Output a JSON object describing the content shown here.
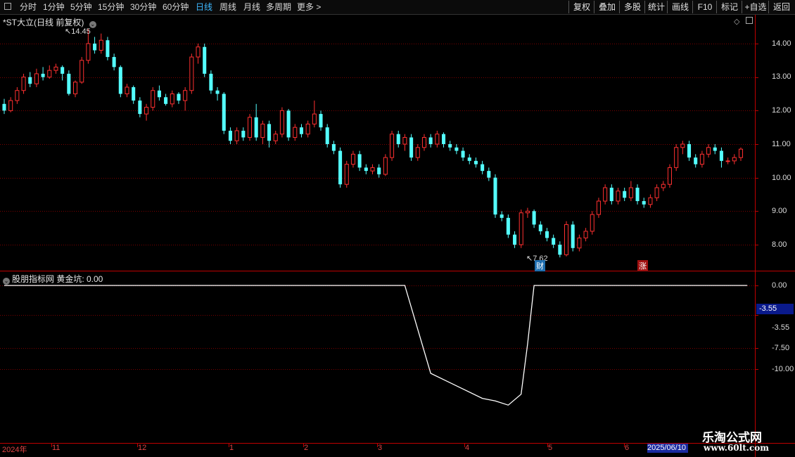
{
  "toolbar": {
    "periods": [
      "分时",
      "1分钟",
      "5分钟",
      "15分钟",
      "30分钟",
      "60分钟",
      "日线",
      "周线",
      "月线",
      "多周期",
      "更多 >"
    ],
    "active": "日线",
    "right_buttons": [
      "复权",
      "叠加",
      "多股",
      "统计",
      "画线",
      "F10",
      "标记",
      "+自选",
      "返回"
    ]
  },
  "main_chart": {
    "title": "*ST大立(日线 前复权)",
    "high_label": "14.45",
    "low_label": "7.62",
    "y_ticks": [
      "14.00",
      "13.00",
      "12.00",
      "11.00",
      "10.00",
      "9.00",
      "8.00"
    ],
    "event_labels": [
      "财",
      "涨"
    ]
  },
  "indicator": {
    "title": "股朋指标网  黄金坑: 0.00",
    "y_ticks": [
      "0.00",
      "-3.55",
      "-7.50",
      "-10.00"
    ],
    "current_value": "-3.55"
  },
  "x_axis": {
    "labels": [
      "2024年",
      "11",
      "12",
      "1",
      "2",
      "3",
      "4",
      "5",
      "6"
    ],
    "highlight": "2025/06/10"
  },
  "watermark": {
    "line1": "乐淘公式网",
    "line2": "www.60lt.com"
  },
  "colors": {
    "up": "#ff3030",
    "down": "#54ffff",
    "grid": "#7a0000",
    "axis": "#c00000",
    "line": "#ffffff"
  },
  "chart_data": {
    "type": "candlestick",
    "y_range": [
      7.4,
      14.8
    ],
    "candles": [
      [
        12.2,
        12.0,
        12.35,
        11.9
      ],
      [
        12.0,
        12.3,
        12.4,
        11.95
      ],
      [
        12.3,
        12.6,
        12.7,
        12.2
      ],
      [
        12.6,
        13.0,
        13.1,
        12.5
      ],
      [
        13.0,
        12.8,
        13.15,
        12.7
      ],
      [
        12.8,
        13.1,
        13.25,
        12.7
      ],
      [
        13.1,
        13.0,
        13.3,
        12.9
      ],
      [
        13.0,
        13.2,
        13.35,
        12.95
      ],
      [
        13.2,
        13.3,
        13.4,
        13.1
      ],
      [
        13.3,
        13.1,
        13.35,
        12.9
      ],
      [
        13.1,
        12.5,
        13.2,
        12.45
      ],
      [
        12.5,
        12.85,
        12.9,
        12.4
      ],
      [
        12.85,
        13.5,
        13.6,
        12.8
      ],
      [
        13.5,
        14.0,
        14.45,
        13.4
      ],
      [
        14.0,
        13.8,
        14.2,
        13.7
      ],
      [
        13.8,
        14.1,
        14.3,
        13.7
      ],
      [
        14.1,
        13.6,
        14.2,
        13.5
      ],
      [
        13.6,
        13.3,
        13.7,
        13.2
      ],
      [
        13.3,
        12.5,
        13.35,
        12.4
      ],
      [
        12.5,
        12.7,
        12.8,
        12.4
      ],
      [
        12.7,
        12.3,
        12.75,
        12.2
      ],
      [
        12.3,
        11.9,
        12.4,
        11.8
      ],
      [
        11.9,
        12.1,
        12.2,
        11.7
      ],
      [
        12.1,
        12.6,
        12.7,
        12.0
      ],
      [
        12.6,
        12.4,
        12.75,
        12.3
      ],
      [
        12.4,
        12.2,
        12.5,
        12.15
      ],
      [
        12.2,
        12.5,
        12.6,
        12.1
      ],
      [
        12.5,
        12.3,
        12.55,
        12.2
      ],
      [
        12.3,
        12.6,
        12.7,
        12.0
      ],
      [
        12.6,
        13.6,
        13.7,
        12.5
      ],
      [
        13.6,
        13.9,
        14.0,
        13.4
      ],
      [
        13.9,
        13.1,
        14.0,
        13.0
      ],
      [
        13.1,
        12.6,
        13.2,
        12.5
      ],
      [
        12.6,
        12.5,
        12.7,
        12.3
      ],
      [
        12.5,
        11.4,
        12.55,
        11.3
      ],
      [
        11.4,
        11.1,
        11.5,
        11.0
      ],
      [
        11.1,
        11.4,
        11.5,
        11.0
      ],
      [
        11.4,
        11.2,
        11.5,
        11.1
      ],
      [
        11.2,
        11.8,
        11.9,
        11.1
      ],
      [
        11.8,
        11.2,
        12.2,
        11.1
      ],
      [
        11.2,
        11.6,
        11.7,
        11.0
      ],
      [
        11.6,
        11.1,
        11.7,
        10.9
      ],
      [
        11.1,
        11.3,
        11.4,
        11.0
      ],
      [
        11.3,
        12.0,
        12.1,
        11.2
      ],
      [
        12.0,
        11.2,
        12.05,
        11.1
      ],
      [
        11.2,
        11.5,
        11.6,
        11.1
      ],
      [
        11.5,
        11.3,
        11.6,
        11.2
      ],
      [
        11.3,
        11.6,
        11.7,
        11.2
      ],
      [
        11.6,
        11.9,
        12.3,
        11.5
      ],
      [
        11.9,
        11.5,
        12.0,
        11.4
      ],
      [
        11.5,
        11.0,
        11.6,
        10.9
      ],
      [
        11.0,
        10.8,
        11.1,
        10.7
      ],
      [
        10.8,
        9.8,
        10.9,
        9.7
      ],
      [
        9.8,
        10.4,
        10.5,
        9.7
      ],
      [
        10.4,
        10.7,
        10.8,
        10.3
      ],
      [
        10.7,
        10.3,
        10.8,
        10.2
      ],
      [
        10.3,
        10.2,
        10.4,
        10.1
      ],
      [
        10.2,
        10.3,
        10.4,
        10.1
      ],
      [
        10.3,
        10.1,
        10.4,
        10.0
      ],
      [
        10.1,
        10.6,
        10.7,
        10.05
      ],
      [
        10.6,
        11.3,
        11.4,
        10.5
      ],
      [
        11.3,
        11.0,
        11.4,
        10.9
      ],
      [
        11.0,
        11.2,
        11.3,
        10.8
      ],
      [
        11.2,
        10.6,
        11.3,
        10.5
      ],
      [
        10.6,
        10.9,
        11.0,
        10.5
      ],
      [
        10.9,
        11.2,
        11.3,
        10.8
      ],
      [
        11.2,
        11.0,
        11.3,
        10.9
      ],
      [
        11.0,
        11.3,
        11.4,
        10.9
      ],
      [
        11.3,
        11.0,
        11.35,
        10.9
      ],
      [
        11.0,
        10.9,
        11.1,
        10.8
      ],
      [
        10.9,
        10.8,
        11.0,
        10.7
      ],
      [
        10.8,
        10.6,
        10.9,
        10.5
      ],
      [
        10.6,
        10.5,
        10.7,
        10.4
      ],
      [
        10.5,
        10.4,
        10.6,
        10.3
      ],
      [
        10.4,
        10.2,
        10.5,
        10.1
      ],
      [
        10.2,
        10.0,
        10.3,
        9.9
      ],
      [
        10.0,
        8.9,
        10.1,
        8.8
      ],
      [
        8.9,
        8.8,
        9.0,
        8.7
      ],
      [
        8.8,
        8.3,
        8.9,
        8.2
      ],
      [
        8.3,
        8.0,
        8.4,
        7.9
      ],
      [
        8.0,
        8.95,
        9.05,
        7.9
      ],
      [
        8.95,
        9.0,
        9.1,
        8.8
      ],
      [
        9.0,
        8.6,
        9.05,
        8.5
      ],
      [
        8.6,
        8.4,
        8.7,
        8.3
      ],
      [
        8.4,
        8.2,
        8.5,
        8.1
      ],
      [
        8.2,
        8.0,
        8.3,
        7.9
      ],
      [
        8.0,
        7.7,
        8.1,
        7.62
      ],
      [
        7.7,
        8.6,
        8.7,
        7.65
      ],
      [
        8.6,
        7.9,
        8.7,
        7.8
      ],
      [
        7.9,
        8.2,
        8.3,
        7.8
      ],
      [
        8.2,
        8.4,
        8.5,
        8.1
      ],
      [
        8.4,
        8.9,
        9.0,
        8.3
      ],
      [
        8.9,
        9.3,
        9.4,
        8.8
      ],
      [
        9.3,
        9.7,
        9.8,
        9.2
      ],
      [
        9.7,
        9.3,
        9.8,
        9.2
      ],
      [
        9.3,
        9.6,
        9.7,
        9.2
      ],
      [
        9.6,
        9.4,
        9.7,
        9.3
      ],
      [
        9.4,
        9.7,
        9.9,
        9.3
      ],
      [
        9.7,
        9.3,
        9.8,
        9.2
      ],
      [
        9.3,
        9.2,
        9.4,
        9.1
      ],
      [
        9.2,
        9.4,
        9.5,
        9.1
      ],
      [
        9.4,
        9.7,
        9.8,
        9.3
      ],
      [
        9.7,
        9.8,
        9.9,
        9.6
      ],
      [
        9.8,
        10.3,
        10.4,
        9.7
      ],
      [
        10.3,
        10.9,
        11.0,
        10.2
      ],
      [
        10.9,
        11.0,
        11.1,
        10.7
      ],
      [
        11.0,
        10.6,
        11.1,
        10.5
      ],
      [
        10.6,
        10.4,
        10.7,
        10.3
      ],
      [
        10.4,
        10.7,
        10.8,
        10.3
      ],
      [
        10.7,
        10.9,
        11.0,
        10.6
      ],
      [
        10.9,
        10.8,
        11.0,
        10.7
      ],
      [
        10.8,
        10.5,
        10.9,
        10.3
      ],
      [
        10.5,
        10.5,
        10.6,
        10.4
      ],
      [
        10.5,
        10.6,
        10.7,
        10.4
      ],
      [
        10.6,
        10.85,
        10.9,
        10.5
      ]
    ],
    "indicator_series": [
      [
        0,
        0
      ],
      [
        62,
        0
      ],
      [
        66,
        -10.5
      ],
      [
        70,
        -12.0
      ],
      [
        74,
        -13.5
      ],
      [
        76,
        -13.8
      ],
      [
        78,
        -14.3
      ],
      [
        80,
        -13.0
      ],
      [
        81,
        -7.0
      ],
      [
        82,
        0
      ],
      [
        115,
        0
      ]
    ]
  }
}
